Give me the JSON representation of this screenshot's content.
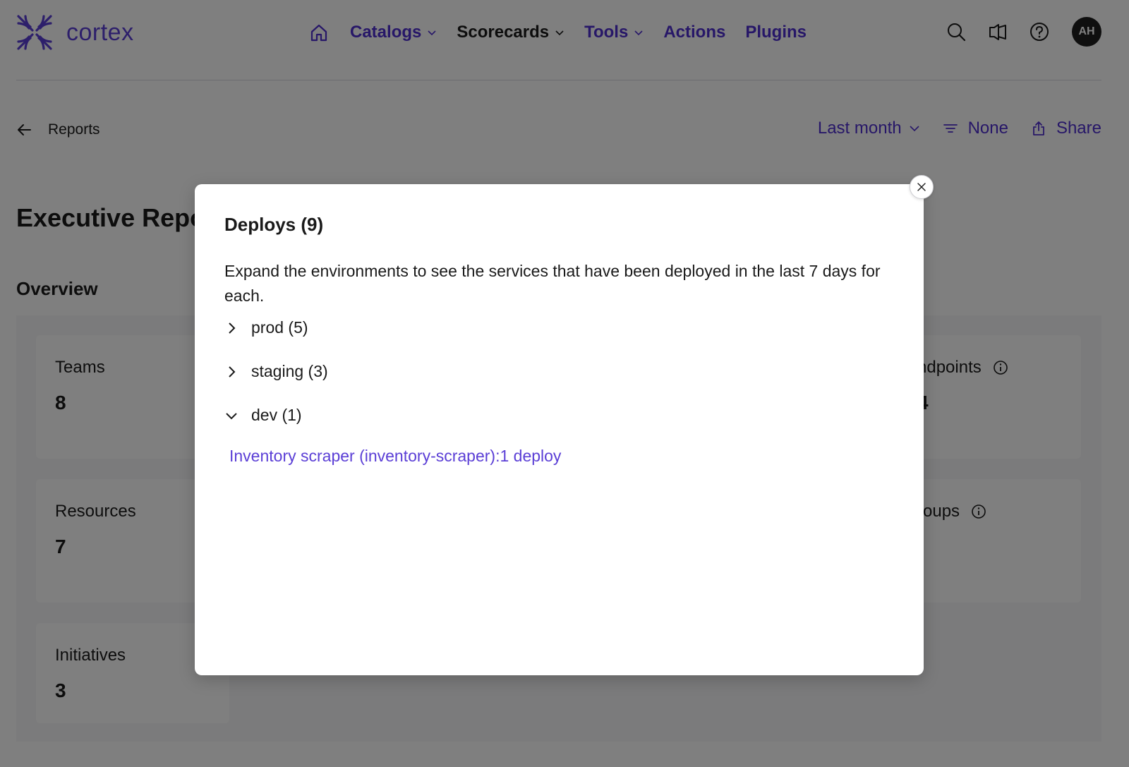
{
  "header": {
    "logo_text": "cortex",
    "nav": {
      "catalogs": "Catalogs",
      "scorecards": "Scorecards",
      "tools": "Tools",
      "actions": "Actions",
      "plugins": "Plugins"
    },
    "avatar_initials": "AH",
    "icons": [
      "home-icon",
      "search-icon",
      "announcement-icon",
      "help-icon"
    ]
  },
  "subheader": {
    "back_label": "Reports",
    "date_range": "Last month",
    "filter_label": "None",
    "share_label": "Share"
  },
  "page": {
    "title": "Executive Repo",
    "section_title": "Overview"
  },
  "cards": {
    "teams": {
      "label": "Teams",
      "value": "8"
    },
    "resources": {
      "label": "Resources",
      "value": "7"
    },
    "initiatives": {
      "label": "Initiatives",
      "value": "3"
    },
    "endpoints": {
      "label": "ndpoints",
      "value": "4"
    },
    "groups": {
      "label": "roups",
      "value": ""
    }
  },
  "modal": {
    "title": "Deploys (9)",
    "description": "Expand the environments to see the services that have been deployed in the last 7 days for each.",
    "environments": [
      {
        "label": "prod (5)",
        "expanded": false
      },
      {
        "label": "staging (3)",
        "expanded": false
      },
      {
        "label": "dev (1)",
        "expanded": true
      }
    ],
    "dev_services": [
      {
        "label": "Inventory scraper (inventory-scraper):1 deploy"
      }
    ]
  },
  "colors": {
    "brand": "#5b3fd6",
    "nav_link": "#4f2fd0",
    "text": "#1a1a1a"
  }
}
